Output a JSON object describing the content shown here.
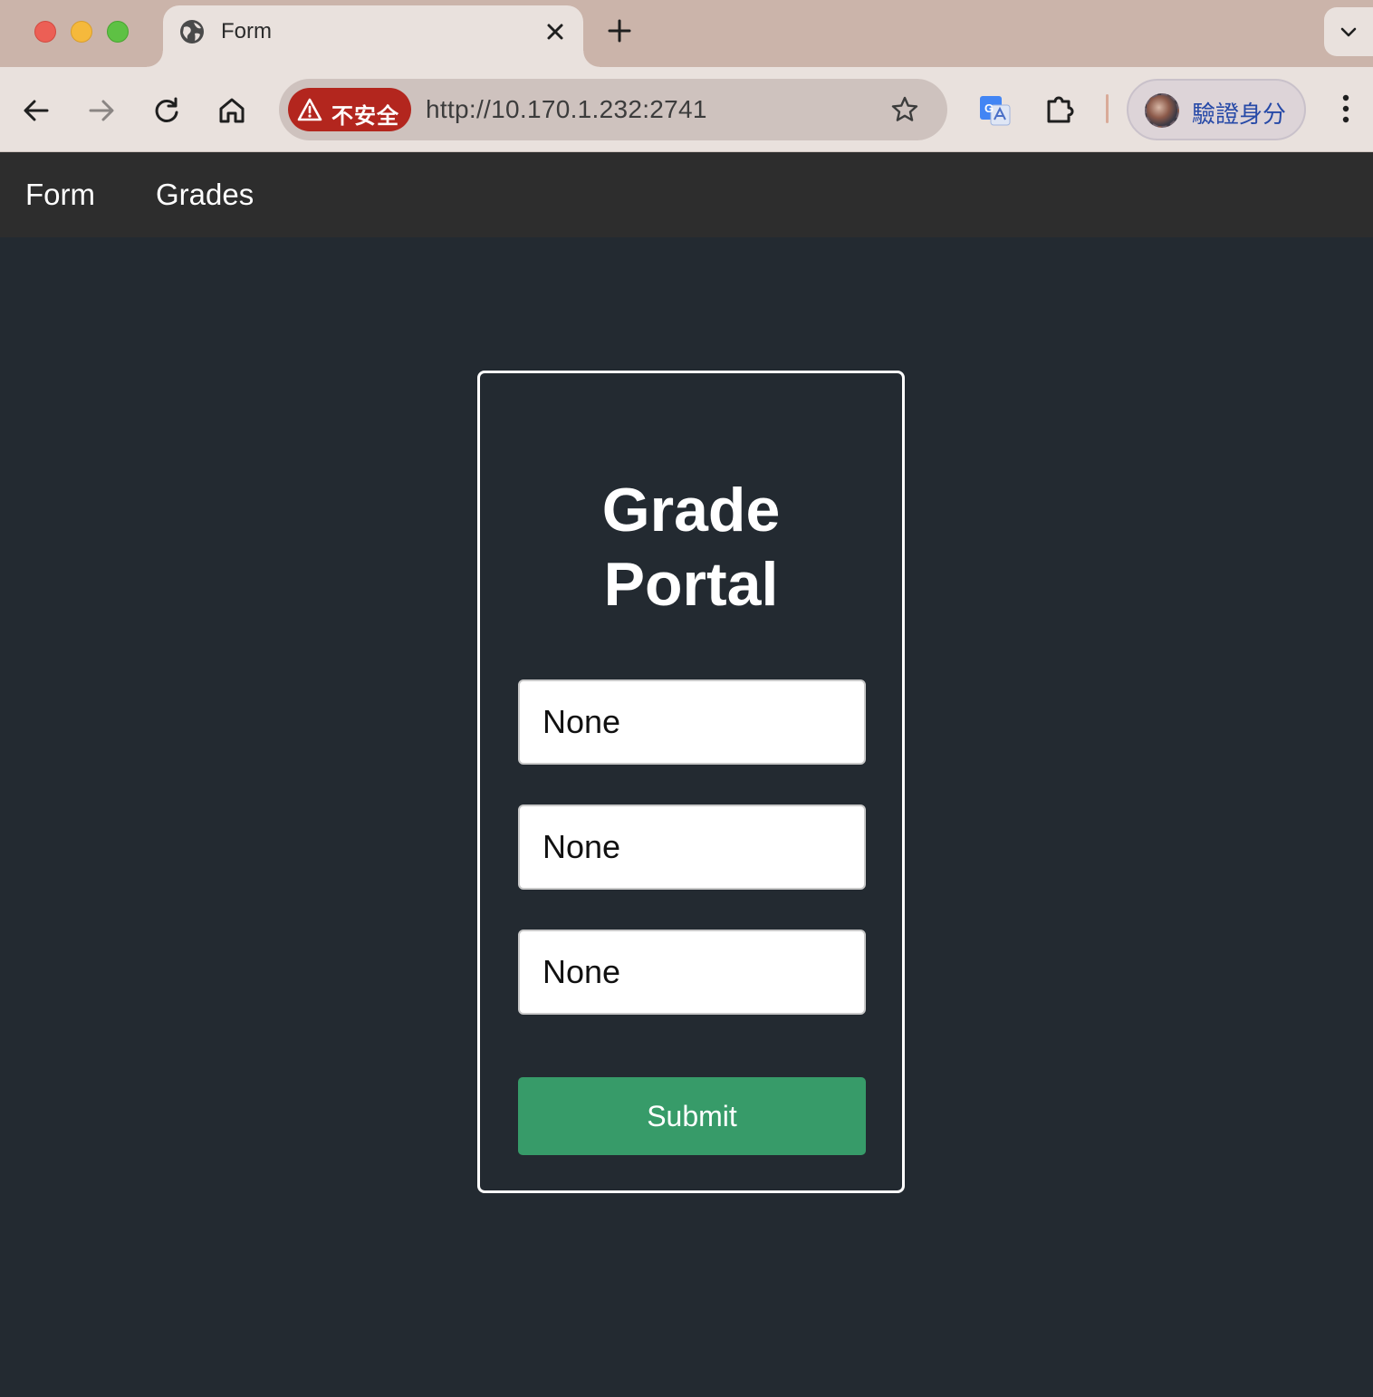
{
  "browser": {
    "tab": {
      "title": "Form",
      "favicon": "globe-icon"
    },
    "address": {
      "security_label": "不安全",
      "url": "http://10.170.1.232:2741"
    },
    "profile": {
      "label": "驗證身分"
    }
  },
  "nav": {
    "links": [
      {
        "label": "Form"
      },
      {
        "label": "Grades"
      }
    ]
  },
  "form": {
    "title_line1": "Grade",
    "title_line2": "Portal",
    "fields": [
      {
        "value": "None"
      },
      {
        "value": "None"
      },
      {
        "value": "None"
      }
    ],
    "submit_label": "Submit"
  },
  "colors": {
    "page_bg": "#232a31",
    "navbar_bg": "#2d2d2d",
    "submit_bg": "#379b69",
    "security_chip": "#b3261e"
  }
}
